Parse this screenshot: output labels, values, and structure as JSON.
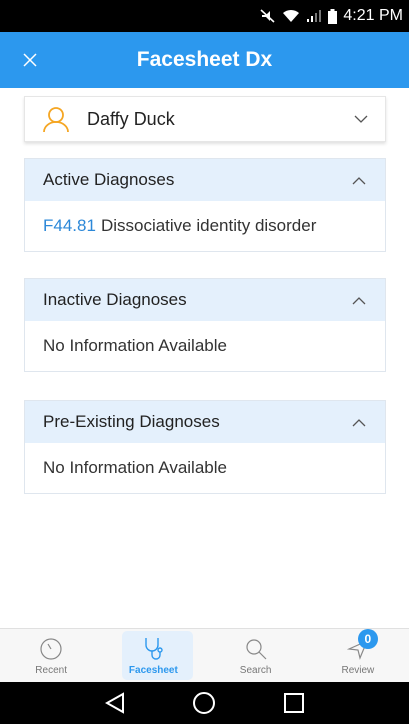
{
  "status_bar": {
    "time": "4:21 PM"
  },
  "app_bar": {
    "title": "Facesheet Dx"
  },
  "patient": {
    "name": "Daffy Duck"
  },
  "panels": [
    {
      "title": "Active Diagnoses",
      "code": "F44.81",
      "text": "Dissociative identity disorder"
    },
    {
      "title": "Inactive Diagnoses",
      "text": "No Information Available"
    },
    {
      "title": "Pre-Existing Diagnoses",
      "text": "No Information Available"
    }
  ],
  "bottom_nav": {
    "items": [
      {
        "label": "Recent",
        "icon": "clock-icon"
      },
      {
        "label": "Facesheet",
        "icon": "stethoscope-icon",
        "active": true
      },
      {
        "label": "Search",
        "icon": "search-icon"
      },
      {
        "label": "Review",
        "icon": "send-icon",
        "badge": "0"
      }
    ]
  },
  "colors": {
    "primary": "#2c98ee",
    "panel_header": "#e4f0fc",
    "avatar": "#f5a623",
    "link": "#2c88d8"
  }
}
